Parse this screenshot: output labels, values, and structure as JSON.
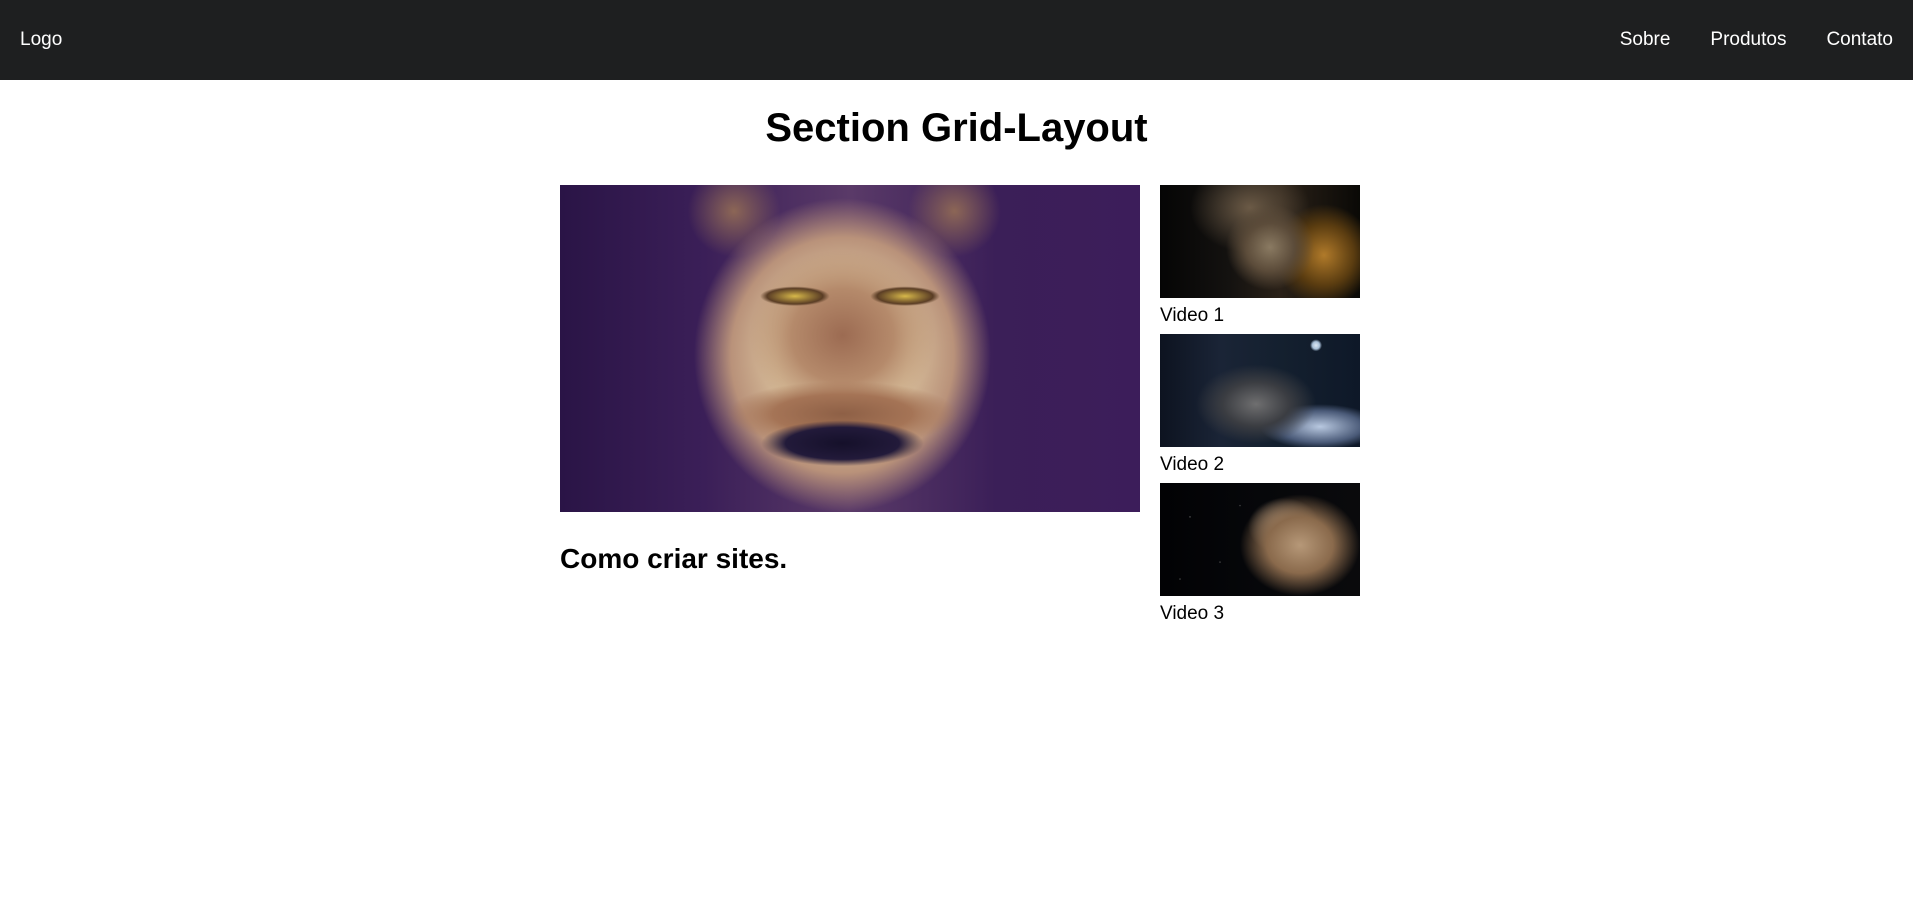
{
  "header": {
    "logo": "Logo",
    "nav": [
      {
        "label": "Sobre"
      },
      {
        "label": "Produtos"
      },
      {
        "label": "Contato"
      }
    ],
    "background_color": "#1e1f20"
  },
  "section": {
    "title": "Section Grid-Layout",
    "main": {
      "image": "wolf-face-image",
      "heading": "Como criar sites."
    },
    "videos": [
      {
        "label": "Video 1",
        "image": "wolf-image-1"
      },
      {
        "label": "Video 2",
        "image": "wolf-image-2"
      },
      {
        "label": "Video 3",
        "image": "wolf-image-3"
      }
    ]
  }
}
